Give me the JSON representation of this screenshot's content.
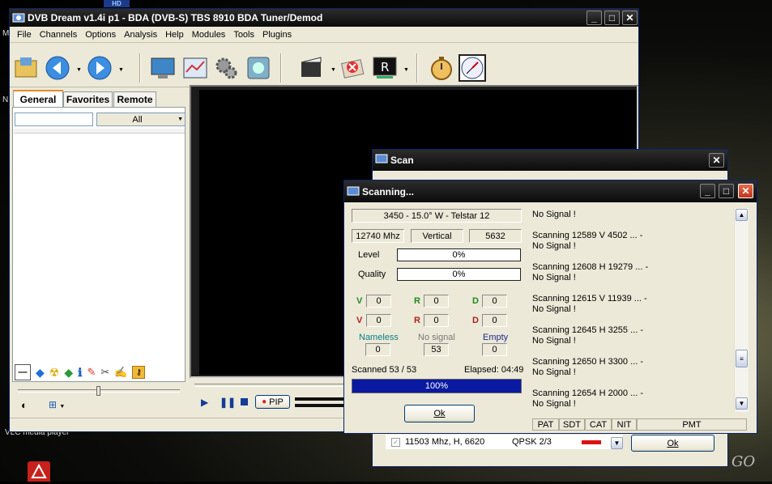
{
  "desktop": {
    "shortcut_label": "VLC media player",
    "side_letter_1": "M",
    "side_letter_2": "N",
    "top_badge": "HD",
    "corner_mark": "GO"
  },
  "main_window": {
    "title": "DVB Dream v1.4i p1 - BDA (DVB-S)   TBS 8910 BDA Tuner/Demod",
    "menu": [
      "File",
      "Channels",
      "Options",
      "Analysis",
      "Help",
      "Modules",
      "Tools",
      "Plugins"
    ],
    "toolbar_icons": [
      "open-icon",
      "back-icon",
      "forward-icon",
      "monitor-icon",
      "epg-icon",
      "settings-icon",
      "dish-icon",
      "record-icon",
      "stop-icon",
      "teletext-icon",
      "timer-icon",
      "clock-icon"
    ],
    "tabs": [
      "General",
      "Favorites",
      "Remote"
    ],
    "filter_value": "All",
    "search_value": "",
    "pip_label": "PIP",
    "colors": {
      "title_bg": "#111111",
      "accent": "#e68b2c",
      "close_red": "#d9482b"
    }
  },
  "scan_window": {
    "title": "Scan",
    "last_row": {
      "freq": "11503 Mhz, H, 6620",
      "mod": "QPSK 2/3",
      "color": "#dd1111"
    },
    "ok_label": "Ok"
  },
  "scanning_dialog": {
    "title": "Scanning...",
    "satellite": "3450 - 15.0° W - Telstar 12",
    "freq": "12740 Mhz",
    "polarization": "Vertical",
    "symbol_rate": "5632",
    "level_label": "Level",
    "level_value": "0%",
    "quality_label": "Quality",
    "quality_value": "0%",
    "counts": [
      [
        {
          "l": "V",
          "v": "0",
          "c": "#1e8a1e"
        },
        {
          "l": "R",
          "v": "0",
          "c": "#1e8a1e"
        },
        {
          "l": "D",
          "v": "0",
          "c": "#1e8a1e"
        }
      ],
      [
        {
          "l": "V",
          "v": "0",
          "c": "#b01e1e"
        },
        {
          "l": "R",
          "v": "0",
          "c": "#b01e1e"
        },
        {
          "l": "D",
          "v": "0",
          "c": "#b01e1e"
        }
      ]
    ],
    "nameless_label": "Nameless",
    "nameless_value": "0",
    "nosignal_label": "No signal",
    "nosignal_value": "53",
    "empty_label": "Empty",
    "empty_value": "0",
    "scanned_text": "Scanned 53 / 53",
    "elapsed_text": "Elapsed: 04:49",
    "progress_text": "100%",
    "progress": 1.0,
    "ok_label": "Ok",
    "log": [
      "No Signal !",
      "",
      "Scanning 12589 V 4502 ... -",
      "No Signal !",
      "",
      "Scanning 12608 H 19279 ... -",
      "No Signal !",
      "",
      "Scanning 12615 V 11939 ... -",
      "No Signal !",
      "",
      "Scanning 12645 H 3255 ... -",
      "No Signal !",
      "",
      "Scanning 12650 H 3300 ... -",
      "No Signal !",
      "",
      "Scanning 12654 H 2000 ... -",
      "No Signal !"
    ],
    "table_tabs": [
      "PAT",
      "SDT",
      "CAT",
      "NIT",
      "PMT"
    ]
  }
}
